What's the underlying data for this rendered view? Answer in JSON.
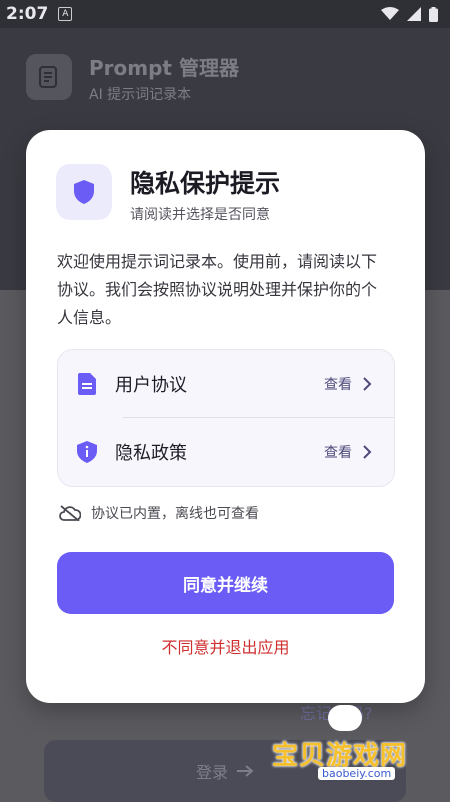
{
  "status_bar": {
    "time": "2:07"
  },
  "background": {
    "title": "Prompt 管理器",
    "subtitle": "AI 提示词记录本",
    "forgot_label": "忘记密码?",
    "login_label": "登录"
  },
  "dialog": {
    "title": "隐私保护提示",
    "subtitle": "请阅读并选择是否同意",
    "body": "欢迎使用提示词记录本。使用前，请阅读以下协议。我们会按照协议说明处理并保护你的个人信息。",
    "links": [
      {
        "label": "用户协议",
        "action": "查看",
        "icon": "document-icon"
      },
      {
        "label": "隐私政策",
        "action": "查看",
        "icon": "shield-info-icon"
      }
    ],
    "offline_note": "协议已内置，离线也可查看",
    "agree_label": "同意并继续",
    "disagree_label": "不同意并退出应用"
  },
  "watermark": {
    "text": "宝贝游戏网",
    "url": "baobeiy.com"
  },
  "colors": {
    "accent": "#6b5cf5",
    "danger": "#cf2f2f",
    "icon_bg": "#ecebfb"
  }
}
